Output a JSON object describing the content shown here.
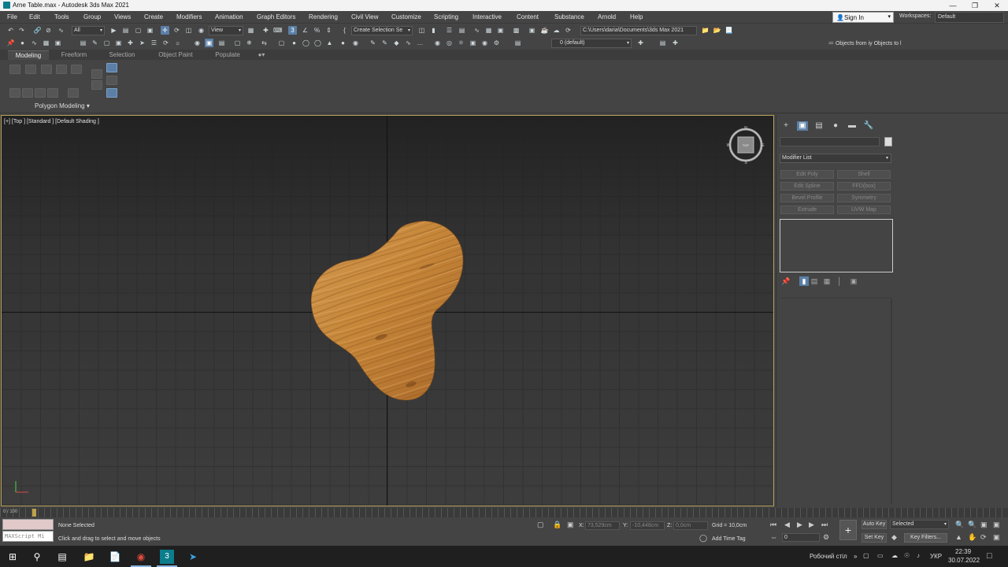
{
  "window": {
    "title": "Arne Table.max - Autodesk 3ds Max 2021"
  },
  "menubar": {
    "items": [
      "File",
      "Edit",
      "Tools",
      "Group",
      "Views",
      "Create",
      "Modifiers",
      "Animation",
      "Graph Editors",
      "Rendering",
      "Civil View",
      "Customize",
      "Scripting",
      "Interactive",
      "Content",
      "Substance",
      "Arnold",
      "Help"
    ],
    "signin": "Sign In",
    "workspaces_label": "Workspaces:",
    "workspace": "Default"
  },
  "toolbar": {
    "filter": "All",
    "ref_coord": "View",
    "selection_set": "Create Selection Se",
    "project_path": "C:\\Users\\daria\\Documents\\3ds Max 2021",
    "layer": "0 (default)",
    "scene_explorer_hint": "≔ Objects from іу Objects to l"
  },
  "ribbon": {
    "tabs": [
      "Modeling",
      "Freeform",
      "Selection",
      "Object Paint",
      "Populate"
    ],
    "active_tab": "Modeling",
    "panel_label": "Polygon Modeling ▾"
  },
  "viewport": {
    "label": "[+] [Top ] [Standard ] [Default Shading ]",
    "viewcube_face": "TOP",
    "compass": {
      "n": "N",
      "s": "S",
      "e": "E",
      "w": "W"
    }
  },
  "command_panel": {
    "modifier_list": "Modifier List",
    "modifiers": [
      "Edit Poly",
      "Shell",
      "Edit Spline",
      "FFD(box)",
      "Bevel Profile",
      "Symmetry",
      "Extrude",
      "UVW Map"
    ]
  },
  "timeslider": {
    "frames": "0 / 100"
  },
  "status": {
    "maxscript_placeholder": "MAXScript Mi",
    "selection": "None Selected",
    "prompt": "Click and drag to select and move objects",
    "x_label": "X:",
    "x_value": "73,529cm",
    "y_label": "Y:",
    "y_value": "-10,448cm",
    "z_label": "Z:",
    "z_value": "0,0cm",
    "grid": "Grid = 10,0cm",
    "add_time_tag": "Add Time Tag",
    "auto_key": "Auto Key",
    "set_key": "Set Key",
    "selected_filter": "Selected",
    "key_filters": "Key Filters...",
    "current_frame": "0"
  },
  "taskbar": {
    "desktop": "Робочий стіл",
    "lang": "УКР",
    "time": "22:39",
    "date": "30.07.2022"
  },
  "colors": {
    "accent": "#5b7fa6",
    "viewport_border": "#b8a35a",
    "wood": "#c98a3e"
  }
}
